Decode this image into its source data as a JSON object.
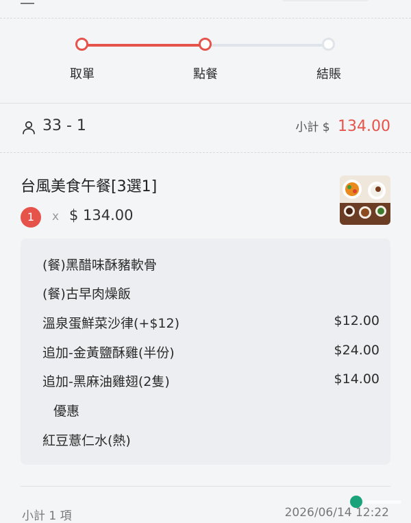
{
  "stepper": {
    "steps": [
      {
        "label": "取單",
        "state": "done"
      },
      {
        "label": "點餐",
        "state": "current"
      },
      {
        "label": "結賬",
        "state": "pending"
      }
    ]
  },
  "table": {
    "icon": "person-icon",
    "number": "33 - 1",
    "subtotal_label": "小計 $",
    "subtotal_amount": "134.00"
  },
  "item": {
    "name": "台風美食午餐[3選1]",
    "quantity": "1",
    "times": "x",
    "price": "$ 134.00",
    "image": "meal-photo",
    "options": [
      {
        "label": "(餐)黑醋味酥豬軟骨",
        "price": ""
      },
      {
        "label": "(餐)古早肉燥飯",
        "price": ""
      },
      {
        "label": "溫泉蛋鮮菜沙律(+$12)",
        "price": "$12.00"
      },
      {
        "label": "追加-金黃鹽酥雞(半份)",
        "price": "$24.00"
      },
      {
        "label": "追加-黑麻油雞翅(2隻)",
        "price": "$14.00"
      },
      {
        "label": "優惠",
        "price": ""
      },
      {
        "label": "紅豆薏仁水(熱)",
        "price": ""
      }
    ]
  },
  "footer": {
    "left": "小計 1 項",
    "right": "2026/06/14 12:22"
  },
  "colors": {
    "accent": "#e5534b",
    "inactive": "#dfe4ea",
    "background": "#f4f5f7",
    "option_box": "#eceef1"
  }
}
